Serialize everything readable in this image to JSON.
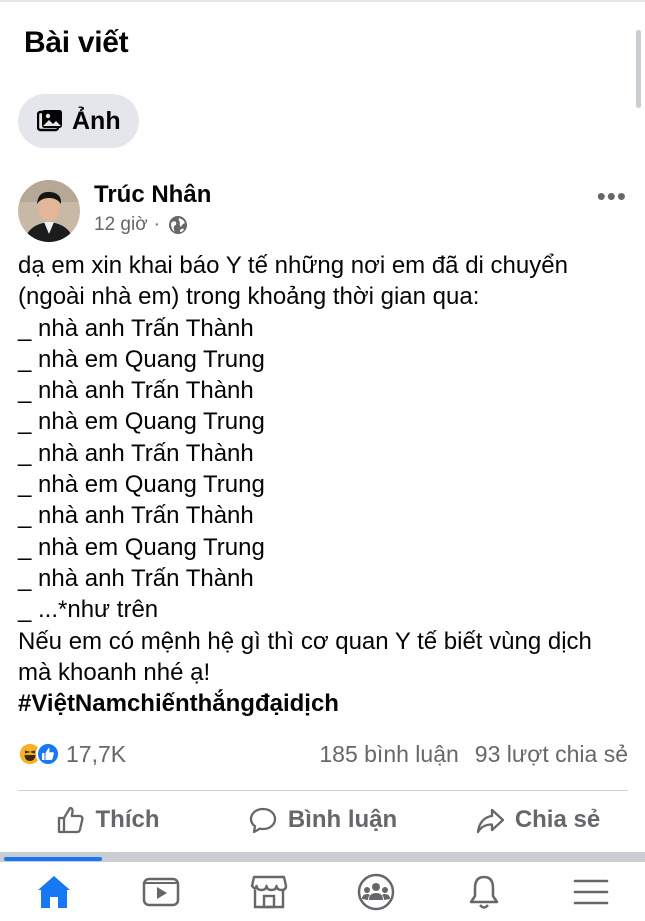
{
  "section": {
    "title": "Bài viết"
  },
  "filter_chip": {
    "label": "Ảnh",
    "icon": "photo-icon"
  },
  "post": {
    "author": "Trúc Nhân",
    "time": "12 giờ",
    "separator": "·",
    "privacy_icon": "globe-icon",
    "more_label": "•••",
    "lines": [
      "dạ em xin khai báo Y tế những nơi em đã di chuyển",
      "(ngoài nhà em) trong khoảng thời gian qua:",
      "_ nhà anh Trấn Thành",
      "_ nhà em Quang Trung",
      "_ nhà anh Trấn Thành",
      "_ nhà em Quang Trung",
      "_ nhà anh Trấn Thành",
      "_ nhà em Quang Trung",
      "_ nhà anh Trấn Thành",
      "_ nhà em Quang Trung",
      "_ nhà anh Trấn Thành",
      "_ ...*như trên",
      "Nếu em có mệnh hệ gì thì cơ quan Y tế biết vùng dịch",
      "mà khoanh nhé ạ!"
    ],
    "hashtag": "#ViệtNamchiếnthắngđạidịch"
  },
  "stats": {
    "reactions": "17,7K",
    "reaction_icons": [
      "haha-icon",
      "like-icon"
    ],
    "comments": "185 bình luận",
    "shares": "93 lượt chia sẻ"
  },
  "actions": {
    "like": "Thích",
    "comment": "Bình luận",
    "share": "Chia sẻ"
  },
  "tabbar": {
    "items": [
      "home-icon",
      "watch-icon",
      "marketplace-icon",
      "groups-icon",
      "notifications-icon",
      "menu-icon"
    ],
    "active": "home-icon"
  },
  "colors": {
    "accent": "#1877f2",
    "secondary_text": "#65676b",
    "chip_bg": "#e4e6eb"
  }
}
